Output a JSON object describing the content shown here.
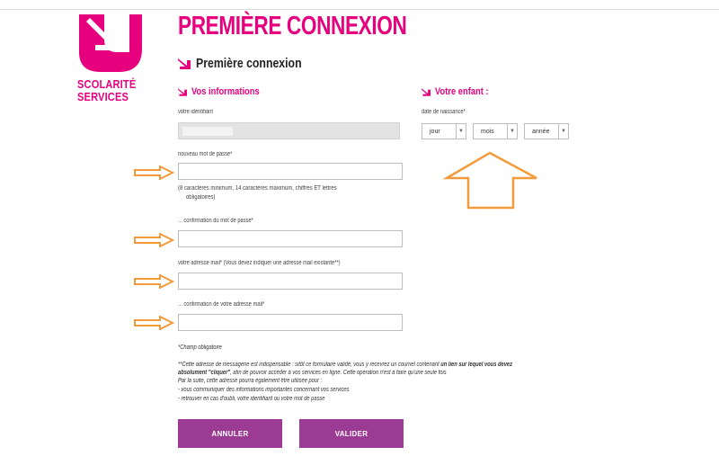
{
  "logo": {
    "line1": "Scolarité",
    "line2": "Services",
    "icon": "arrow-in-circle-icon"
  },
  "header": {
    "title": "PREMIÈRE CONNEXION",
    "subtitle": "Première connexion"
  },
  "info_section": {
    "heading": "Vos informations",
    "identifier_label": "votre identifiant",
    "new_password_label": "nouveau mot de passe*",
    "password_hint_line1": "(8 caractères minimum, 14 caractères maximum, chiffres ET lettres",
    "password_hint_line2": "obligatoires)",
    "confirm_password_label": "... confirmation du mot de passe*",
    "email_label": "votre adresse mail* (Vous devez indiquer une adresse mail existante**)",
    "confirm_email_label": "... confirmation de votre adresse mail*"
  },
  "child_section": {
    "heading": "Votre enfant :",
    "birthdate_label": "date de naissance*",
    "day": "jour",
    "month": "mois",
    "year": "année"
  },
  "notes": {
    "required": "*Champ obligatoire",
    "line1_a": "**Cette adresse de messagerie est indispensable : sitôt ce formulaire validé, vous y recevrez un courriel contenant ",
    "line1_b": "un lien sur lequel vous devez",
    "line2_a": "absolument \"cliquer\"",
    "line2_b": ", afin de pouvoir accéder à vos services en ligne. Cette opération n'est à faire qu'une seule fois",
    "line3": "Par la suite, cette adresse pourra également être utilisée pour :",
    "line4": "- vous communiquer des informations importantes concernant vos services",
    "line5": "- retrouver en cas d'oubli, votre identifiant ou votre mot de passe"
  },
  "buttons": {
    "cancel": "ANNULER",
    "validate": "VALIDER"
  },
  "colors": {
    "brand": "#e6007e",
    "button": "#9c3b93",
    "annotation": "#f39a3b"
  }
}
